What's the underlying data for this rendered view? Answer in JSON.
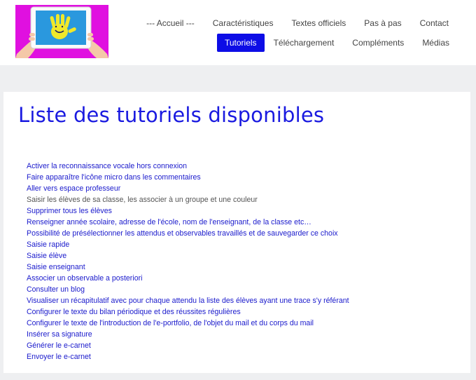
{
  "header": {
    "nav_row1": [
      "--- Accueil ---",
      "Caractéristiques",
      "Textes officiels",
      "Pas à pas",
      "Contact"
    ],
    "nav_row2": [
      "Tutoriels",
      "Téléchargement",
      "Compléments",
      "Médias"
    ],
    "active_item": "Tutoriels"
  },
  "main": {
    "title": "Liste des tutoriels disponibles",
    "items": [
      "Activer la reconnaissance vocale hors connexion",
      "Faire apparaître l'icône micro dans les commentaires",
      "Aller vers espace professeur",
      "Saisir les élèves de sa classe, les associer à un groupe et une couleur",
      "Supprimer tous les élèves",
      "Renseigner année scolaire, adresse de l'école, nom de l'enseignant, de la classe etc…",
      "Possibilité de présélectionner les attendus et observables travaillés et de sauvegarder ce choix",
      "Saisie rapide",
      "Saisie élève",
      "Saisie enseignant",
      "Associer un observable a posteriori",
      "Consulter un blog",
      "Visualiser un récapitulatif avec pour chaque attendu la liste des élèves ayant une trace s'y référant",
      "Configurer le texte du bilan périodique et des réussites régulières",
      "Configurer le texte de l'introduction de l'e-portfolio, de l'objet du mail et du corps du mail",
      "Insérer sa signature",
      "Générer le e-carnet",
      "Envoyer le e-carnet"
    ]
  },
  "colors": {
    "accent": "#0d0de6",
    "link": "#1a1acc",
    "logo_bg": "#e010e0",
    "page_bg": "#eeeff1"
  }
}
